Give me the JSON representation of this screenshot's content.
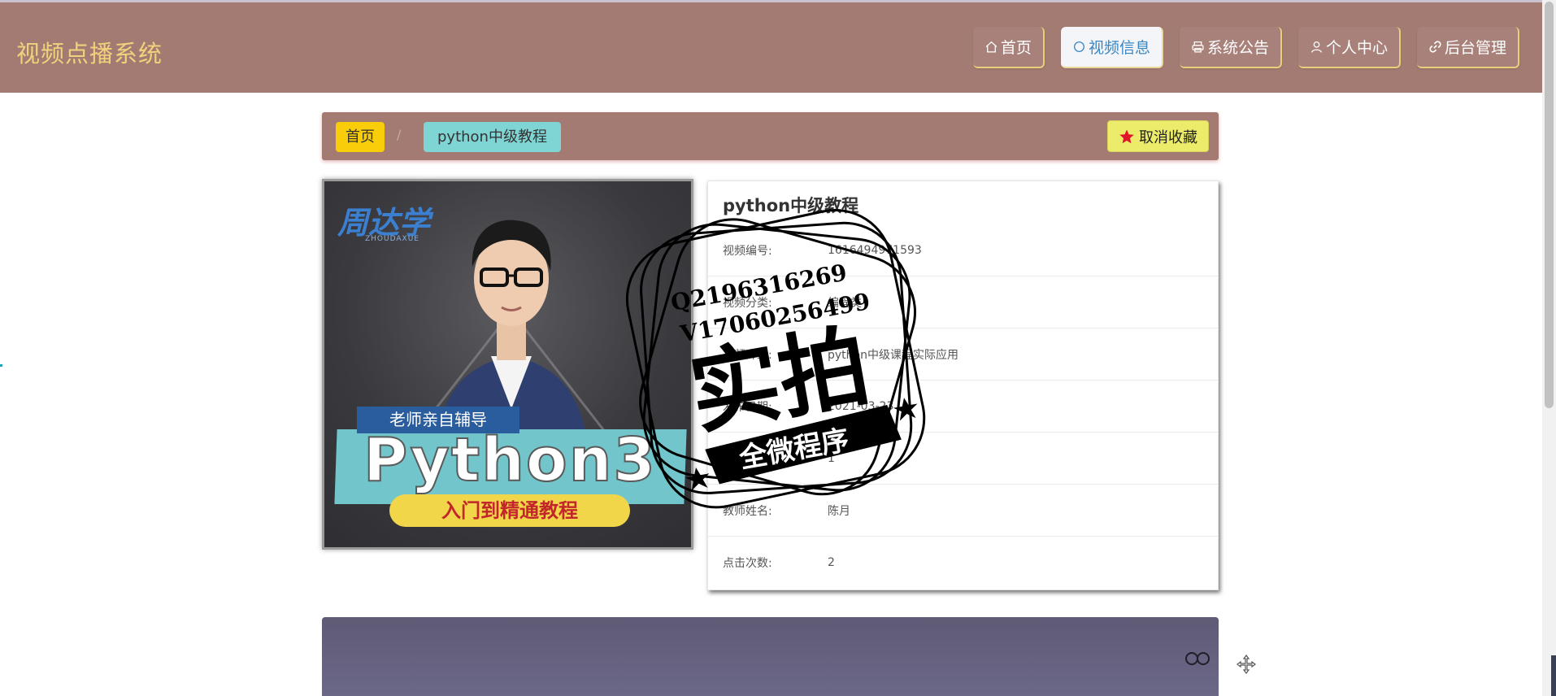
{
  "header": {
    "brand": "视频点播系统",
    "nav": [
      {
        "label": "首页",
        "icon": "home-icon"
      },
      {
        "label": "视频信息",
        "icon": "circle-icon",
        "active": true
      },
      {
        "label": "系统公告",
        "icon": "printer-icon"
      },
      {
        "label": "个人中心",
        "icon": "user-icon"
      },
      {
        "label": "后台管理",
        "icon": "link-icon"
      }
    ]
  },
  "breadcrumb": {
    "home": "首页",
    "separator": "/",
    "current": "python中级教程",
    "favorite_button": "取消收藏"
  },
  "poster": {
    "logo": "周达学",
    "logo_sub": "ZHOUDAXUE",
    "tag": "老师亲自辅导",
    "title": "Python3",
    "subtitle": "入门到精通教程"
  },
  "video_info": {
    "title": "python中级教程",
    "rows": [
      {
        "label": "视频编号:",
        "value": "1616494971593"
      },
      {
        "label": "视频分类:",
        "value": "编程类"
      },
      {
        "label": "视频介绍:",
        "value": "python中级课程实际应用"
      },
      {
        "label": "发布日期:",
        "value": "2021-03-23"
      },
      {
        "label": "教师工号:",
        "value": "1"
      },
      {
        "label": "教师姓名:",
        "value": "陈月"
      },
      {
        "label": "点击次数:",
        "value": "2"
      }
    ]
  },
  "watermark": {
    "line1": "Q2196316269",
    "line2": "V17060256499",
    "main": "实拍",
    "banner": "全微程序"
  },
  "colors": {
    "header_bg": "#a37b72",
    "brand": "#f2d17d",
    "active_nav_text": "#3a86c2",
    "crumb_home": "#f9cd0a",
    "crumb_current": "#7fd5d4",
    "favorite": "#ecec6a",
    "star": "#e0162b"
  }
}
